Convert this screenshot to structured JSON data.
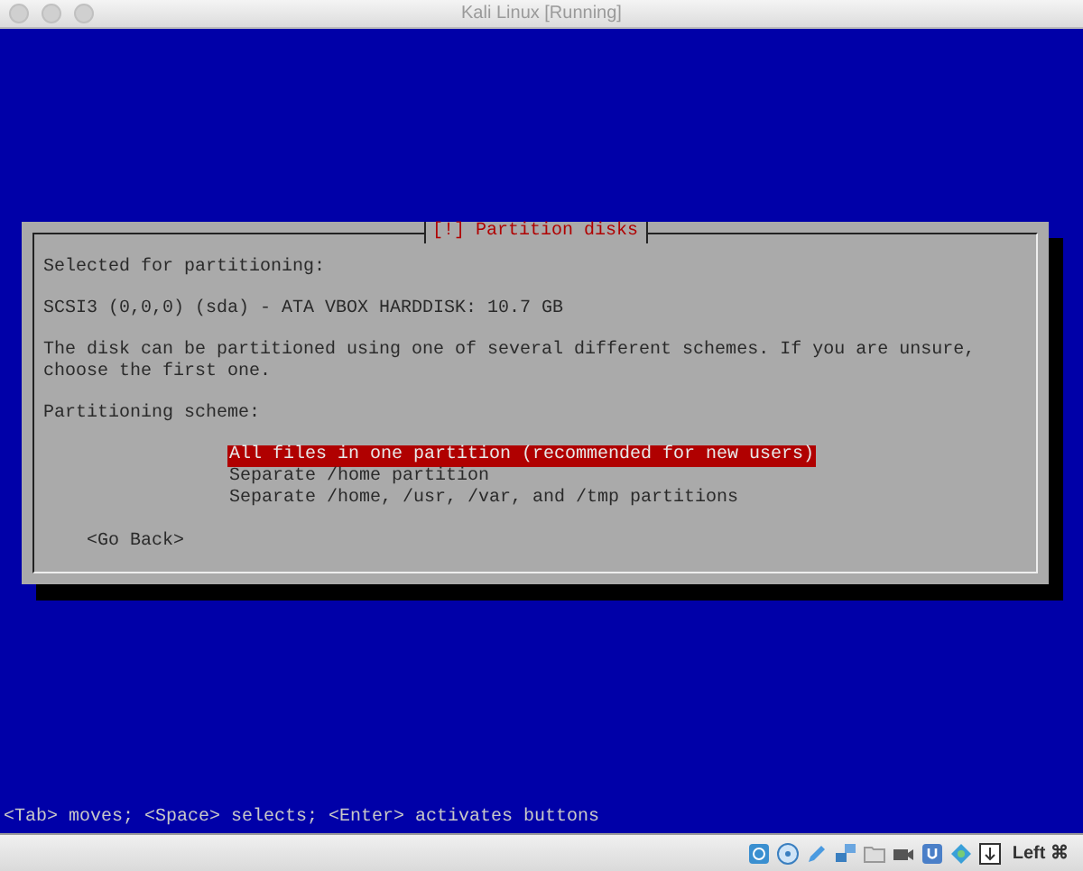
{
  "window": {
    "title": "Kali Linux [Running]"
  },
  "dialog": {
    "title": "[!] Partition disks",
    "paragraphs": [
      "Selected for partitioning:",
      "SCSI3 (0,0,0) (sda) - ATA VBOX HARDDISK: 10.7 GB",
      "The disk can be partitioned using one of several different schemes. If you are unsure, choose the first one."
    ],
    "prompt": "Partitioning scheme:",
    "options": [
      {
        "label": "All files in one partition (recommended for new users)",
        "selected": true
      },
      {
        "label": "Separate /home partition",
        "selected": false
      },
      {
        "label": "Separate /home, /usr, /var, and /tmp partitions",
        "selected": false
      }
    ],
    "buttons": [
      "<Go Back>"
    ]
  },
  "help_line": "<Tab> moves; <Space> selects; <Enter> activates buttons",
  "status_bar": {
    "host_key": "Left ⌘"
  }
}
